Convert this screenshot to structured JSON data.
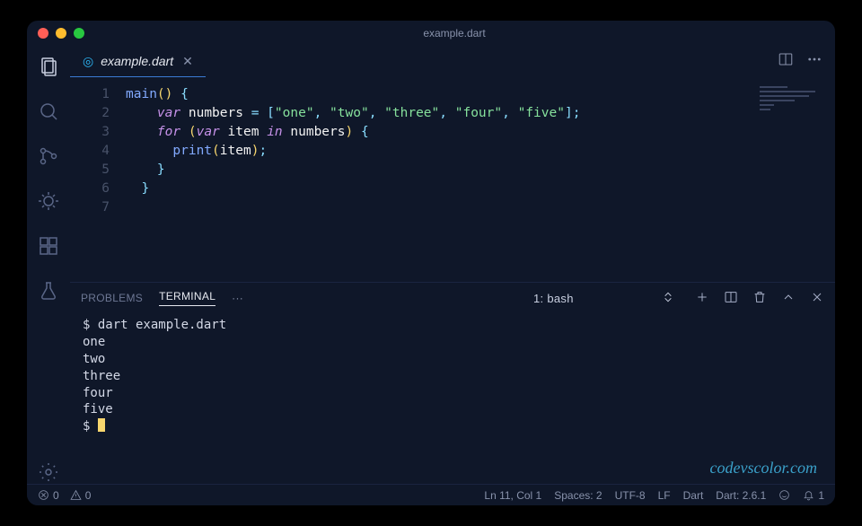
{
  "window": {
    "title": "example.dart"
  },
  "tabs": [
    {
      "label": "example.dart"
    }
  ],
  "code_lines": [
    {
      "n": 1,
      "tokens": [
        [
          "fn",
          "main"
        ],
        [
          "paren",
          "()"
        ],
        [
          "punc",
          " {"
        ]
      ]
    },
    {
      "n": 2,
      "tokens": [
        [
          "var",
          "    "
        ],
        [
          "kw",
          "var"
        ],
        [
          "var",
          " numbers "
        ],
        [
          "punc",
          "= ["
        ],
        [
          "str",
          "\"one\""
        ],
        [
          "punc",
          ", "
        ],
        [
          "str",
          "\"two\""
        ],
        [
          "punc",
          ", "
        ],
        [
          "str",
          "\"three\""
        ],
        [
          "punc",
          ", "
        ],
        [
          "str",
          "\"four\""
        ],
        [
          "punc",
          ", "
        ],
        [
          "str",
          "\"five\""
        ],
        [
          "punc",
          "];"
        ]
      ]
    },
    {
      "n": 3,
      "tokens": [
        [
          "var",
          "    "
        ],
        [
          "kw",
          "for"
        ],
        [
          "var",
          " "
        ],
        [
          "paren",
          "("
        ],
        [
          "kw",
          "var"
        ],
        [
          "var",
          " item "
        ],
        [
          "kw",
          "in"
        ],
        [
          "var",
          " numbers"
        ],
        [
          "paren",
          ")"
        ],
        [
          "punc",
          " {"
        ]
      ]
    },
    {
      "n": 4,
      "tokens": [
        [
          "var",
          "      "
        ],
        [
          "fn",
          "print"
        ],
        [
          "paren",
          "("
        ],
        [
          "var",
          "item"
        ],
        [
          "paren",
          ")"
        ],
        [
          "punc",
          ";"
        ]
      ]
    },
    {
      "n": 5,
      "tokens": [
        [
          "var",
          "    "
        ],
        [
          "punc",
          "}"
        ]
      ]
    },
    {
      "n": 6,
      "tokens": [
        [
          "var",
          "  "
        ],
        [
          "punc",
          "}"
        ]
      ]
    },
    {
      "n": 7,
      "tokens": []
    }
  ],
  "panel": {
    "tabs": {
      "problems": "PROBLEMS",
      "terminal": "TERMINAL"
    },
    "select": "1: bash"
  },
  "terminal_lines": [
    "$ dart example.dart",
    "one",
    "two",
    "three",
    "four",
    "five"
  ],
  "terminal_prompt": "$ ",
  "watermark": "codevscolor.com",
  "status": {
    "errors": "0",
    "warnings": "0",
    "cursor": "Ln 11, Col 1",
    "spaces": "Spaces: 2",
    "encoding": "UTF-8",
    "eol": "LF",
    "lang": "Dart",
    "sdk": "Dart: 2.6.1",
    "notifications": "1"
  }
}
